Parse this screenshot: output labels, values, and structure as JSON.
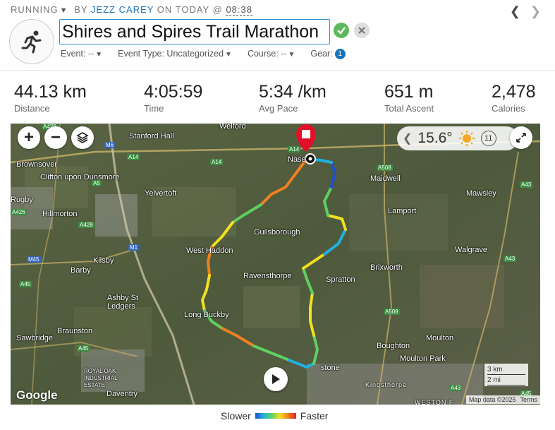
{
  "activity": {
    "type": "RUNNING",
    "by_prefix": "BY",
    "author": "Jezz Carey",
    "on_prefix": "ON TODAY @",
    "time": "08:38",
    "title": "Shires and Spires Trail Marathon",
    "icon": "runner-icon"
  },
  "fields": {
    "event": "Event: --",
    "event_type": "Event Type: Uncategorized",
    "course": "Course: --",
    "gear": "Gear:",
    "gear_count": "1"
  },
  "stats": [
    {
      "value": "44.13 km",
      "label": "Distance"
    },
    {
      "value": "4:05:59",
      "label": "Time"
    },
    {
      "value": "5:34 /km",
      "label": "Avg Pace"
    },
    {
      "value": "651 m",
      "label": "Total Ascent"
    },
    {
      "value": "2,478",
      "label": "Calories"
    }
  ],
  "map": {
    "weather_temp": "15.6°",
    "wind": "11",
    "places": [
      "Welford",
      "Stanford Hall",
      "Brownsover",
      "Clifton upon Dunsmore",
      "Rugby",
      "Hillmorton",
      "Yelvertoft",
      "Nase",
      "Maidwell",
      "Mawsley",
      "Lamport",
      "Guilsborough",
      "West Haddon",
      "Kilsby",
      "Barby",
      "Walgrave",
      "Ravensthorpe",
      "Spratton",
      "Brixworth",
      "Ashby St Ledgers",
      "Long Buckby",
      "Braunston",
      "Sawbridge",
      "Royal Oak Industrial Estate",
      "Daventry",
      "Moulton",
      "Boughton",
      "Moulton Park",
      "Kingsthorpe",
      "Weston F",
      "stone"
    ],
    "roads": [
      "A426",
      "A5",
      "M6",
      "A14",
      "A14",
      "A426",
      "A428",
      "M1",
      "M45",
      "A45",
      "A45",
      "A14",
      "A508",
      "A43",
      "A43",
      "A508",
      "A43",
      "A45"
    ],
    "google": "Google",
    "scale_km": "3 km",
    "scale_mi": "2 mi",
    "attribution": "Map data ©2025",
    "terms": "Terms"
  },
  "legend": {
    "slower": "Slower",
    "faster": "Faster"
  },
  "colors": {
    "accent": "#1a73b8",
    "confirm": "#5cb85c",
    "marker": "#e0102a"
  }
}
